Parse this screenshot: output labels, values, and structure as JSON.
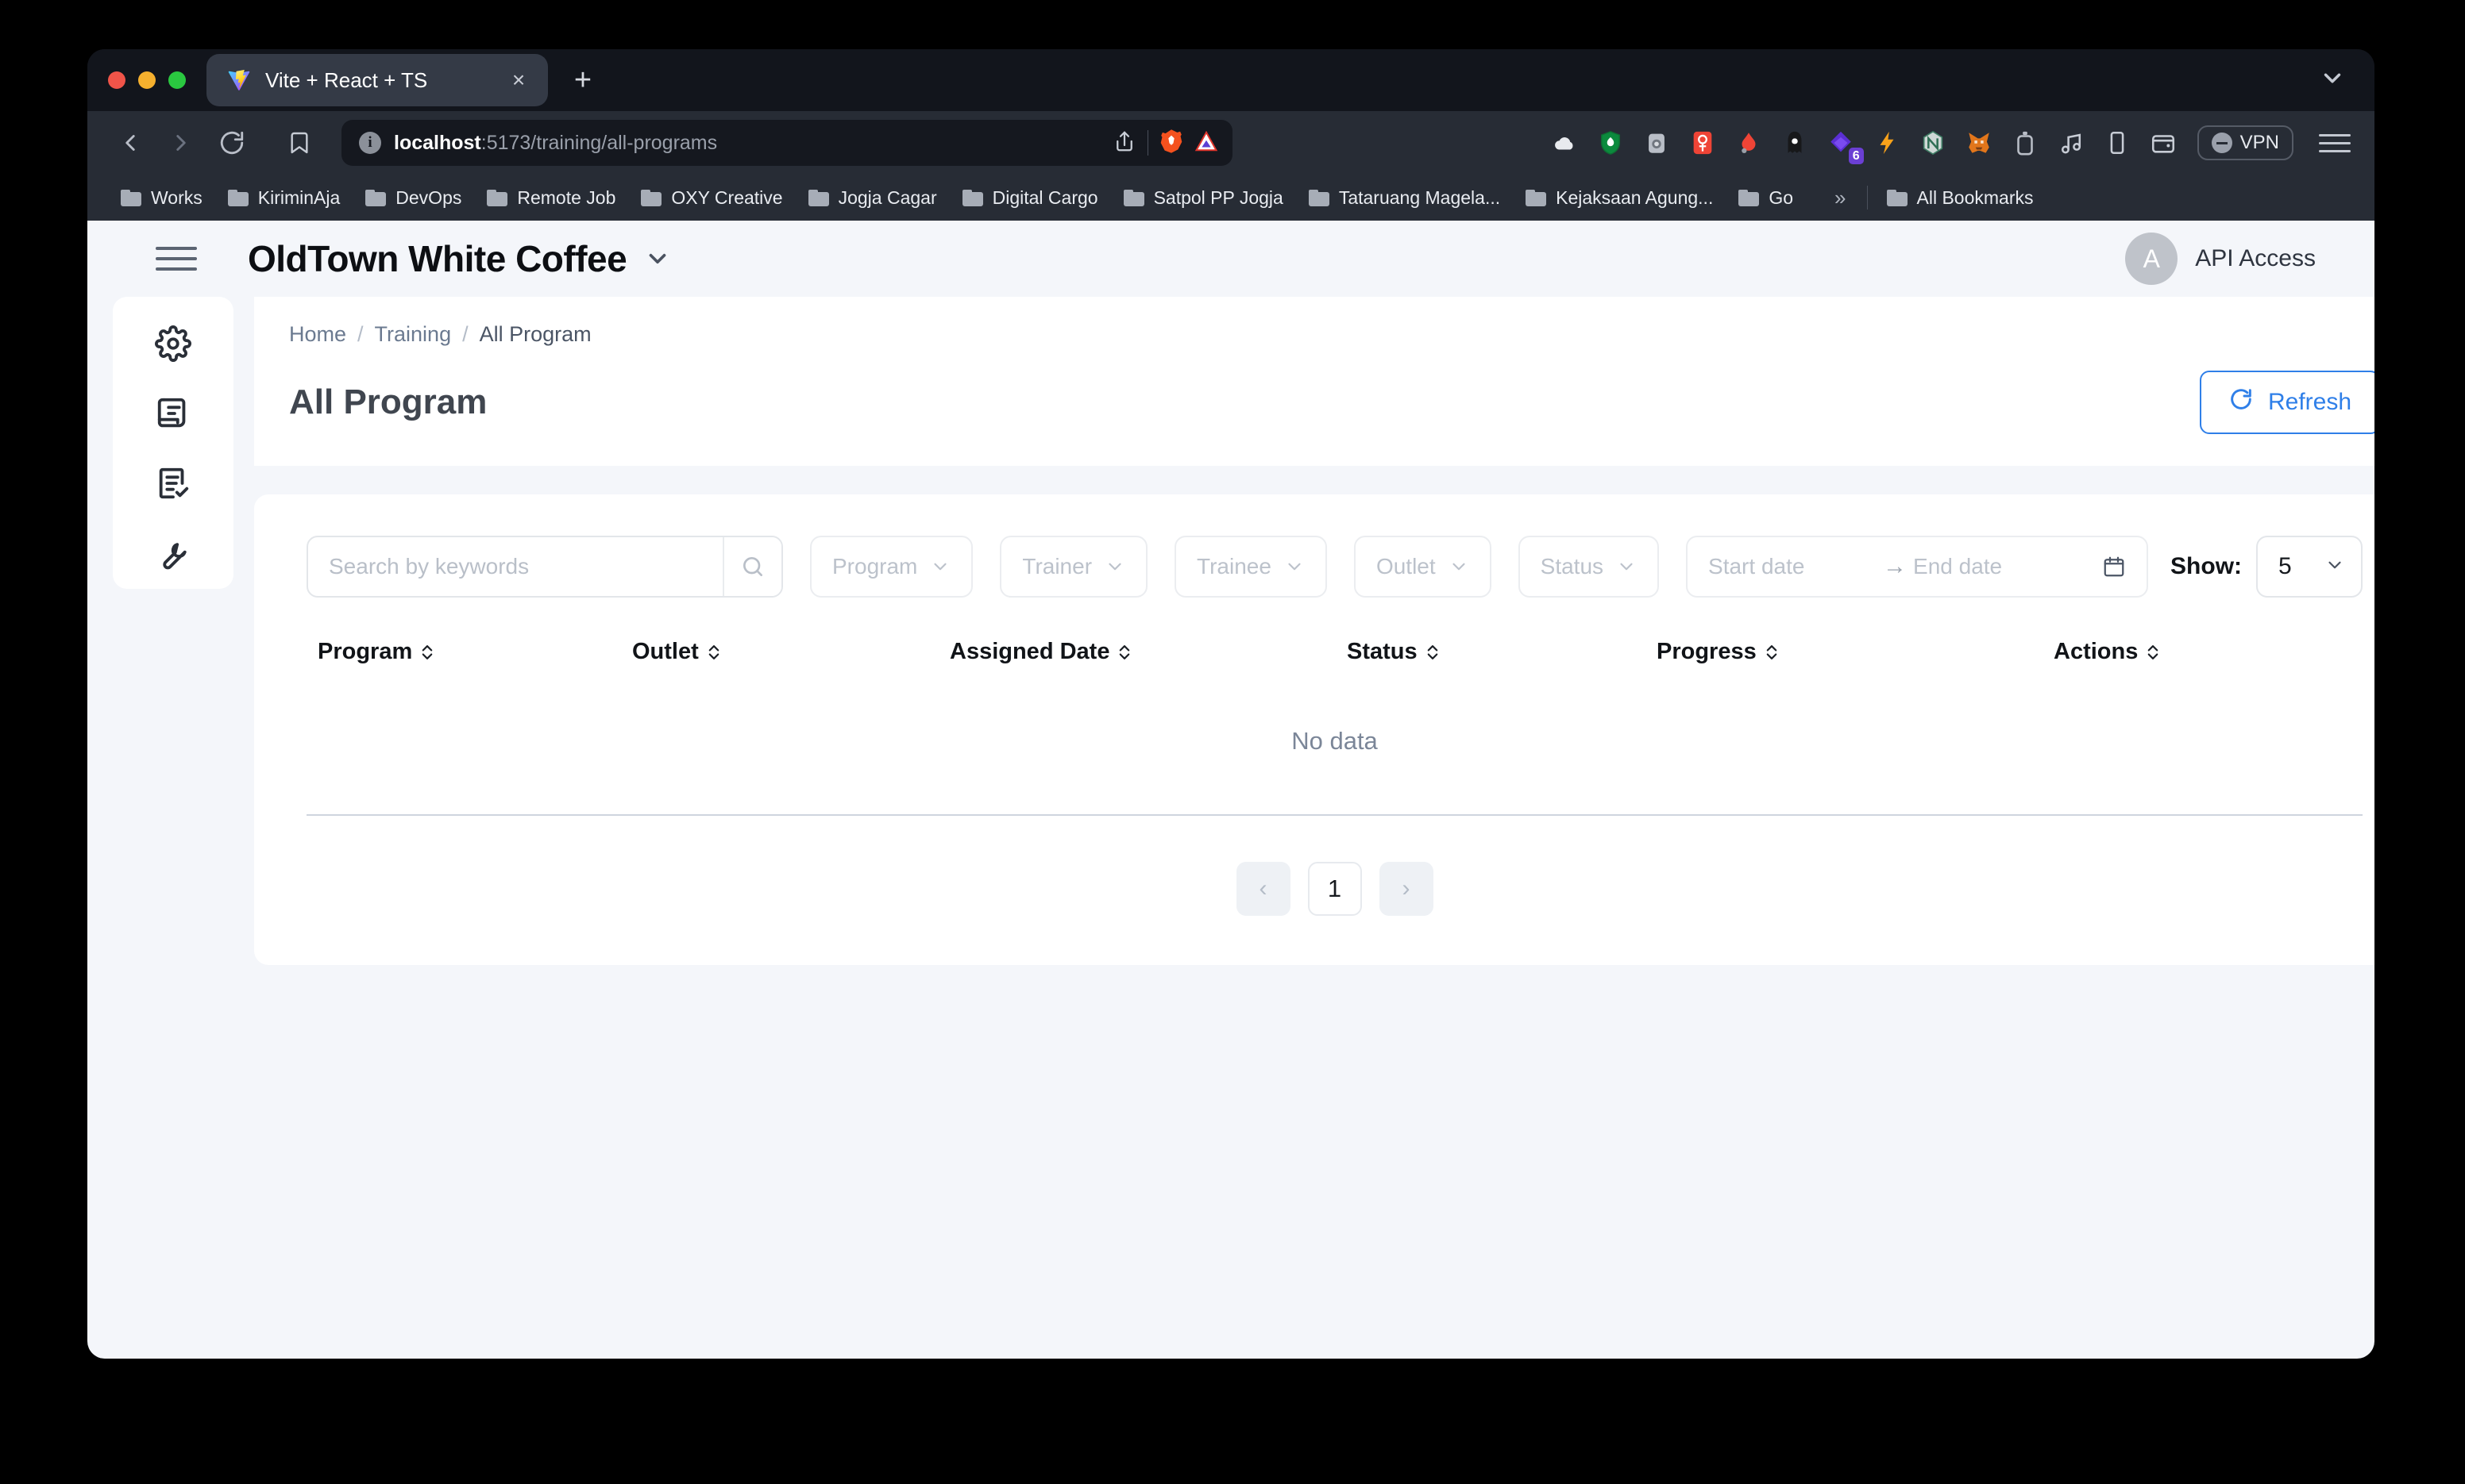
{
  "browser": {
    "tab": {
      "title": "Vite + React + TS",
      "favicon": "vite-logo-icon",
      "close": "×"
    },
    "new_tab_label": "+",
    "url": {
      "scheme_host": "localhost",
      "path": ":5173/training/all-programs",
      "full": "localhost:5173/training/all-programs"
    },
    "vpn_label": "VPN",
    "extensions": [
      "cloud-icon",
      "shield-green-icon",
      "camera-grey-icon",
      "red-app-icon",
      "droplet-red-icon",
      "ghost-icon",
      "purple-diamond-icon",
      "lightning-icon",
      "nord-icon",
      "metamask-fox-icon",
      "bottle-icon",
      "music-note-icon",
      "tablet-icon",
      "wallet-icon"
    ],
    "extension_badge": "6",
    "bookmarks": [
      "Works",
      "KiriminAja",
      "DevOps",
      "Remote Job",
      "OXY Creative",
      "Jogja Cagar",
      "Digital Cargo",
      "Satpol PP Jogja",
      "Tataruang Magela...",
      "Kejaksaan Agung...",
      "Go"
    ],
    "bookmarks_overflow": "»",
    "all_bookmarks_label": "All Bookmarks"
  },
  "app": {
    "header": {
      "menu_icon": "hamburger-icon",
      "brand": "OldTown White Coffee",
      "brand_chevron": "chevron-down-icon",
      "avatar_initial": "A",
      "api_access_label": "API Access"
    },
    "sidebar": {
      "items": [
        {
          "icon": "gear-icon",
          "name": "settings"
        },
        {
          "icon": "receipt-icon",
          "name": "receipt"
        },
        {
          "icon": "clipboard-check-icon",
          "name": "tasks"
        },
        {
          "icon": "wrench-icon",
          "name": "tools"
        }
      ]
    },
    "breadcrumb": {
      "items": [
        "Home",
        "Training",
        "All Program"
      ],
      "separator": "/"
    },
    "page_title": "All Program",
    "refresh_button": {
      "label": "Refresh",
      "icon": "refresh-icon"
    },
    "filters": {
      "search": {
        "placeholder": "Search by keywords",
        "value": "",
        "icon": "search-icon"
      },
      "selects": [
        {
          "label": "Program"
        },
        {
          "label": "Trainer"
        },
        {
          "label": "Trainee"
        },
        {
          "label": "Outlet"
        },
        {
          "label": "Status"
        }
      ],
      "date_range": {
        "start_placeholder": "Start date",
        "end_placeholder": "End date",
        "arrow": "→",
        "icon": "calendar-icon"
      },
      "show": {
        "label": "Show:",
        "value": "5",
        "chevron": "chevron-down-icon"
      }
    },
    "table": {
      "columns": [
        "Program",
        "Outlet",
        "Assigned Date",
        "Status",
        "Progress",
        "Actions"
      ],
      "rows": [],
      "empty_message": "No data"
    },
    "pagination": {
      "prev": "‹",
      "next": "›",
      "pages": [
        "1"
      ],
      "current": "1"
    }
  },
  "colors": {
    "accent_blue": "#2f7fe8",
    "page_bg": "#f4f6fa",
    "card_bg": "#ffffff",
    "text_dark": "#111418",
    "text_muted": "#7b8698",
    "browser_chrome": "#272c35",
    "tabstrip_bg": "#12151c"
  }
}
